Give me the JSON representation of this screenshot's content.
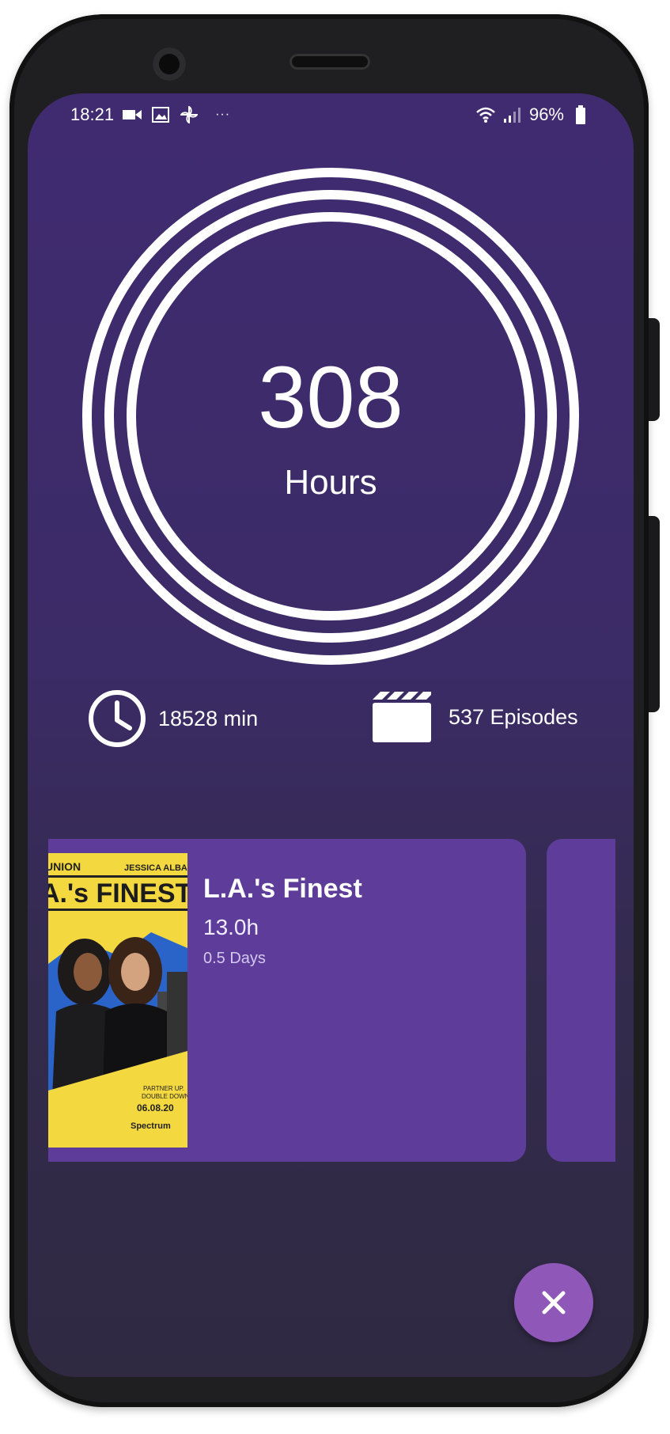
{
  "status_bar": {
    "time": "18:21",
    "battery": "96%"
  },
  "summary": {
    "total": "308",
    "unit": "Hours"
  },
  "stats": {
    "minutes": "18528 min",
    "episodes": "537 Episodes"
  },
  "shows": [
    {
      "title": "L.A.'s Finest",
      "hours": "13.0h",
      "days": "0.5 Days",
      "poster_text": {
        "top_left": "UNION",
        "top_right": "JESSICA ALBA",
        "title": "A.'s FINEST",
        "tagline_1": "PARTNER UP.",
        "tagline_2": "DOUBLE DOWN.",
        "date": "06.08.20",
        "brand": "Spectrum"
      }
    }
  ],
  "colors": {
    "background": "#402b71",
    "card": "#5e3d9a",
    "fab": "#8e57b8",
    "poster": "#f4d83f"
  },
  "icons": {
    "minutes": "clock-icon",
    "episodes": "clapperboard-icon",
    "fab": "close-icon"
  }
}
